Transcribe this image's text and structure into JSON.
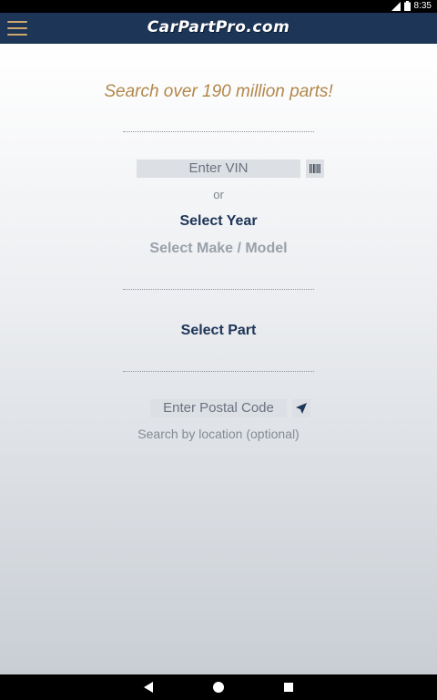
{
  "status": {
    "time": "8:35",
    "icons": [
      "signal-icon",
      "battery-icon"
    ]
  },
  "appbar": {
    "logo_text": "CarPartPro.com",
    "menu_icon": "hamburger-menu-icon"
  },
  "main": {
    "tagline": "Search over 190 million parts!",
    "vin": {
      "placeholder": "Enter VIN",
      "scan_icon": "barcode-icon"
    },
    "or_text": "or",
    "select_year": "Select Year",
    "select_make_model": "Select Make / Model",
    "select_part": "Select Part",
    "postal": {
      "placeholder": "Enter Postal Code",
      "locate_icon": "location-arrow-icon"
    },
    "location_hint": "Search by location (optional)"
  },
  "colors": {
    "navy": "#1d3557",
    "gold": "#b3874a",
    "link_active": "#1d3557",
    "link_disabled": "#9aa1aa"
  }
}
